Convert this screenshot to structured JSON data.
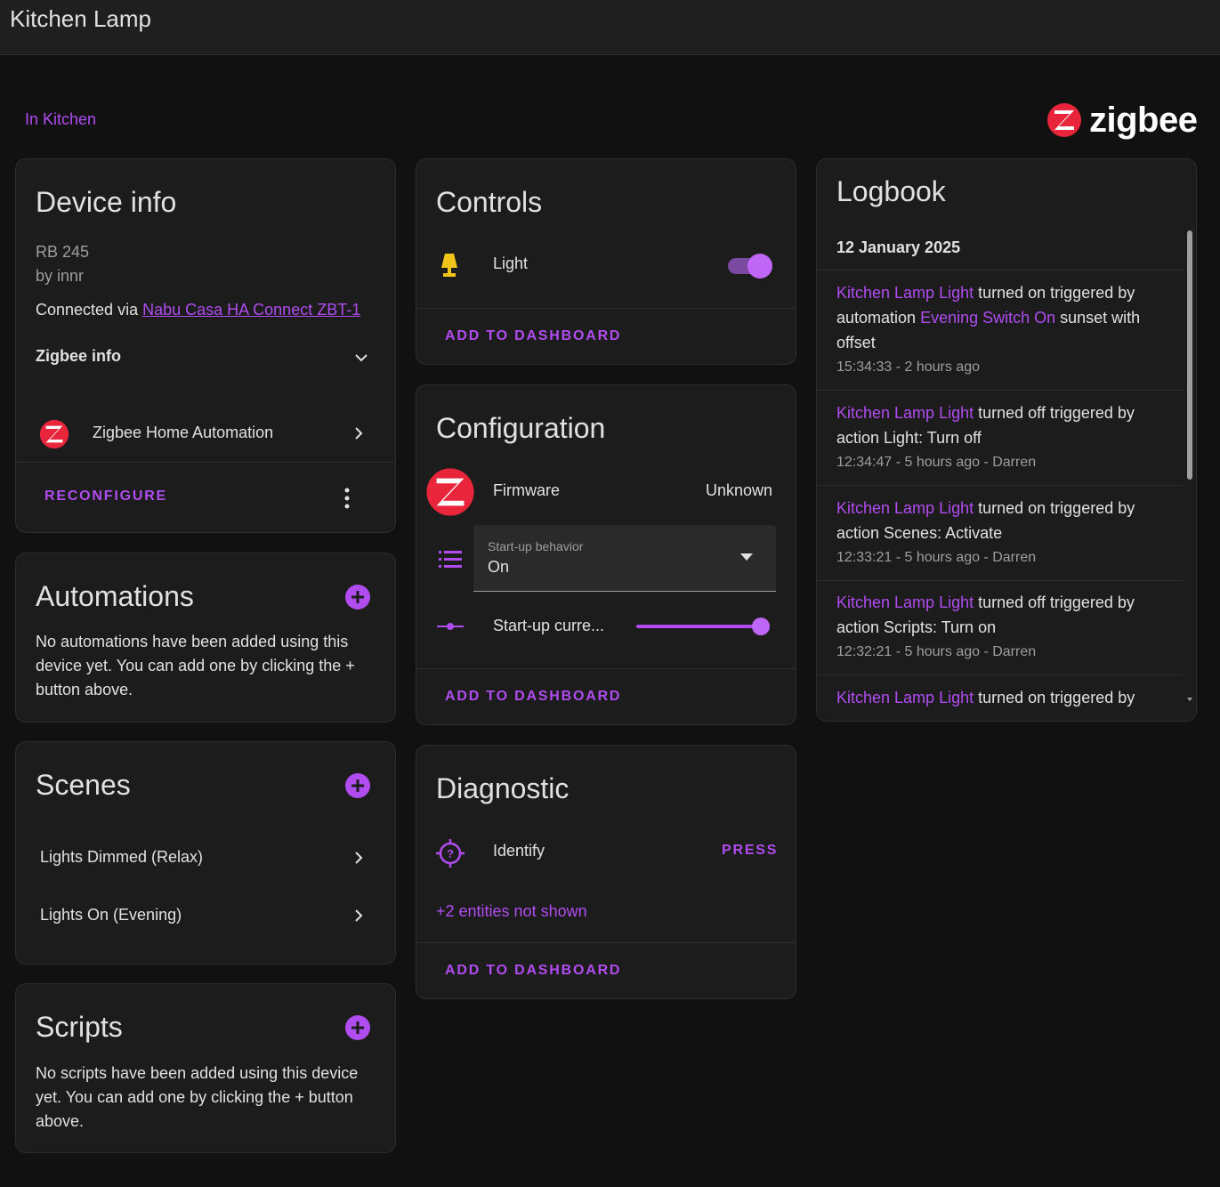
{
  "header": {
    "title": "Kitchen Lamp"
  },
  "area_link": "In Kitchen",
  "brand": {
    "word": "zigbee",
    "accent": "#e8253b"
  },
  "accent_color": "#b14cf0",
  "device_info": {
    "title": "Device info",
    "model": "RB 245",
    "manufacturer": "by innr",
    "connected_prefix": "Connected via",
    "connected_link": "Nabu Casa HA Connect ZBT-1",
    "zigbee_info_label": "Zigbee info",
    "integration_label": "Zigbee Home Automation",
    "reconfigure_label": "Reconfigure"
  },
  "automations": {
    "title": "Automations",
    "empty_text": "No automations have been added using this device yet. You can add one by clicking the + button above."
  },
  "scenes": {
    "title": "Scenes",
    "items": [
      {
        "label": "Lights Dimmed (Relax)"
      },
      {
        "label": "Lights On (Evening)"
      }
    ]
  },
  "scripts": {
    "title": "Scripts",
    "empty_text": "No scripts have been added using this device yet. You can add one by clicking the + button above."
  },
  "controls": {
    "title": "Controls",
    "light_label": "Light",
    "light_on": true,
    "add_to_dashboard": "Add to dashboard"
  },
  "configuration": {
    "title": "Configuration",
    "firmware_label": "Firmware",
    "firmware_value": "Unknown",
    "startup_label": "Start-up behavior",
    "startup_value": "On",
    "startup_current_label": "Start-up curre...",
    "startup_current_level": 1.0,
    "add_to_dashboard": "Add to dashboard"
  },
  "diagnostic": {
    "title": "Diagnostic",
    "identify_label": "Identify",
    "press_label": "Press",
    "hidden_entities": "+2 entities not shown",
    "add_to_dashboard": "Add to dashboard"
  },
  "logbook": {
    "title": "Logbook",
    "date": "12 January 2025",
    "entries": [
      {
        "entity": "Kitchen Lamp Light",
        "text1": " turned on triggered by automation ",
        "link2": "Evening Switch On",
        "text2": " sunset with offset",
        "meta": "15:34:33 - 2 hours ago"
      },
      {
        "entity": "Kitchen Lamp Light",
        "text1": " turned off triggered by action Light: Turn off",
        "link2": "",
        "text2": "",
        "meta": "12:34:47 - 5 hours ago - Darren"
      },
      {
        "entity": "Kitchen Lamp Light",
        "text1": " turned on triggered by action Scenes: Activate",
        "link2": "",
        "text2": "",
        "meta": "12:33:21 - 5 hours ago - Darren"
      },
      {
        "entity": "Kitchen Lamp Light",
        "text1": " turned off triggered by action Scripts: Turn on",
        "link2": "",
        "text2": "",
        "meta": "12:32:21 - 5 hours ago - Darren"
      },
      {
        "entity": "Kitchen Lamp Light",
        "text1": " turned on triggered by",
        "link2": "",
        "text2": "",
        "meta": ""
      }
    ]
  }
}
